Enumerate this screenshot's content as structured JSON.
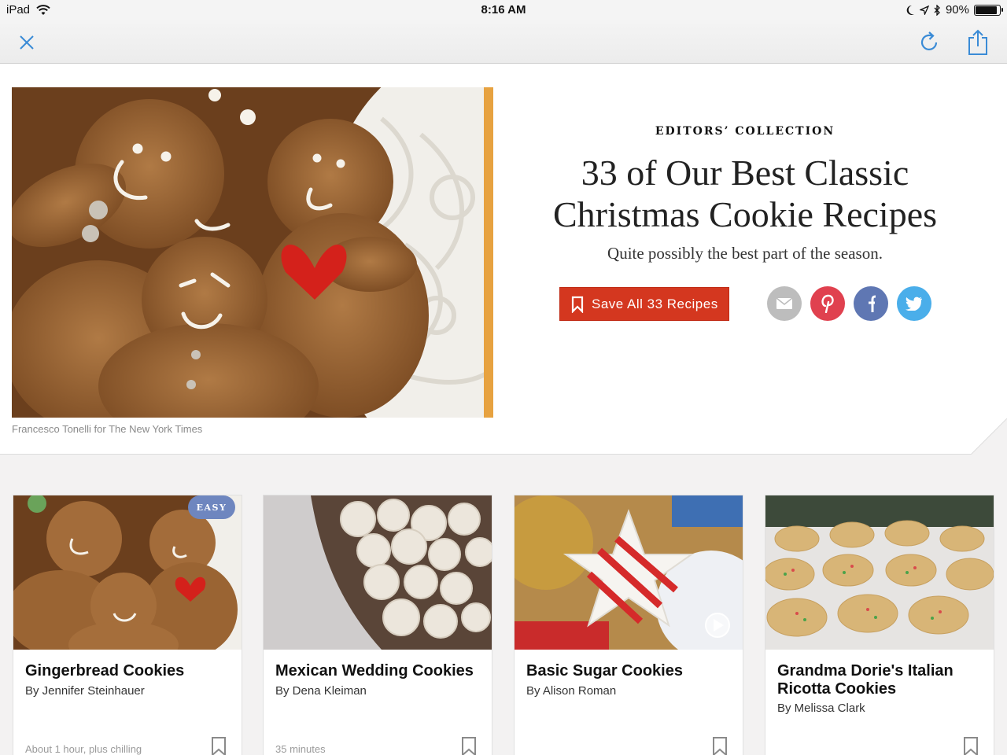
{
  "status_bar": {
    "device": "iPad",
    "time": "8:16 AM",
    "battery": "90%",
    "battery_level": 0.9
  },
  "toolbar": {
    "close_icon": "close-icon",
    "refresh_icon": "refresh-icon",
    "share_icon": "share-icon"
  },
  "hero": {
    "kicker": "EDITORS’ COLLECTION",
    "title": "33 of Our Best Classic Christmas Cookie Recipes",
    "subtitle": "Quite possibly the best part of the season.",
    "save_label": "Save All 33 Recipes",
    "caption": "Francesco Tonelli for The New York Times",
    "share_buttons": [
      {
        "name": "email",
        "color": "#bdbdbd"
      },
      {
        "name": "pinterest",
        "color": "#e0414f"
      },
      {
        "name": "facebook",
        "color": "#5f77b3"
      },
      {
        "name": "twitter",
        "color": "#4aaeea"
      }
    ]
  },
  "colors": {
    "accent_red": "#d4371f",
    "easy_badge": "#6e86bf"
  },
  "cards": [
    {
      "title": "Gingerbread Cookies",
      "author": "By Jennifer Steinhauer",
      "time": "About 1 hour, plus chilling",
      "badge": "EASY"
    },
    {
      "title": "Mexican Wedding Cookies",
      "author": "By Dena Kleiman",
      "time": "35 minutes"
    },
    {
      "title": "Basic Sugar Cookies",
      "author": "By Alison Roman",
      "time": ""
    },
    {
      "title": "Grandma Dorie's Italian Ricotta Cookies",
      "author": "By Melissa Clark",
      "time": ""
    }
  ]
}
